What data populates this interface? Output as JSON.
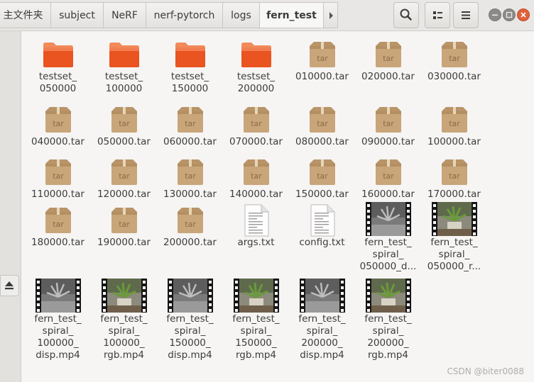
{
  "breadcrumbs": [
    "主文件夹",
    "subject",
    "NeRF",
    "nerf-pytorch",
    "logs",
    "fern_test"
  ],
  "files": [
    {
      "type": "folder",
      "label": "testset_\n050000"
    },
    {
      "type": "folder",
      "label": "testset_\n100000"
    },
    {
      "type": "folder",
      "label": "testset_\n150000"
    },
    {
      "type": "folder",
      "label": "testset_\n200000"
    },
    {
      "type": "tar",
      "label": "010000.tar"
    },
    {
      "type": "tar",
      "label": "020000.tar"
    },
    {
      "type": "tar",
      "label": "030000.tar"
    },
    {
      "type": "tar",
      "label": "040000.tar"
    },
    {
      "type": "tar",
      "label": "050000.tar"
    },
    {
      "type": "tar",
      "label": "060000.tar"
    },
    {
      "type": "tar",
      "label": "070000.tar"
    },
    {
      "type": "tar",
      "label": "080000.tar"
    },
    {
      "type": "tar",
      "label": "090000.tar"
    },
    {
      "type": "tar",
      "label": "100000.tar"
    },
    {
      "type": "tar",
      "label": "110000.tar"
    },
    {
      "type": "tar",
      "label": "120000.tar"
    },
    {
      "type": "tar",
      "label": "130000.tar"
    },
    {
      "type": "tar",
      "label": "140000.tar"
    },
    {
      "type": "tar",
      "label": "150000.tar"
    },
    {
      "type": "tar",
      "label": "160000.tar"
    },
    {
      "type": "tar",
      "label": "170000.tar"
    },
    {
      "type": "tar",
      "label": "180000.tar"
    },
    {
      "type": "tar",
      "label": "190000.tar"
    },
    {
      "type": "tar",
      "label": "200000.tar"
    },
    {
      "type": "text",
      "label": "args.txt"
    },
    {
      "type": "text",
      "label": "config.txt"
    },
    {
      "type": "video-disp",
      "label": "fern_test_\nspiral_\n050000_d..."
    },
    {
      "type": "video-rgb",
      "label": "fern_test_\nspiral_\n050000_r..."
    },
    {
      "type": "video-disp",
      "label": "fern_test_\nspiral_\n100000_\ndisp.mp4"
    },
    {
      "type": "video-rgb",
      "label": "fern_test_\nspiral_\n100000_\nrgb.mp4"
    },
    {
      "type": "video-disp",
      "label": "fern_test_\nspiral_\n150000_\ndisp.mp4"
    },
    {
      "type": "video-rgb",
      "label": "fern_test_\nspiral_\n150000_\nrgb.mp4"
    },
    {
      "type": "video-disp",
      "label": "fern_test_\nspiral_\n200000_\ndisp.mp4"
    },
    {
      "type": "video-rgb",
      "label": "fern_test_\nspiral_\n200000_\nrgb.mp4"
    }
  ],
  "tar_badge": "tar",
  "watermark": "CSDN @biter0088",
  "colors": {
    "folder_orange": "#e95420",
    "folder_light": "#f28a5a",
    "box": "#c9a57a",
    "header_bg": "#e8e7e5",
    "close_button": "#e0603a"
  }
}
